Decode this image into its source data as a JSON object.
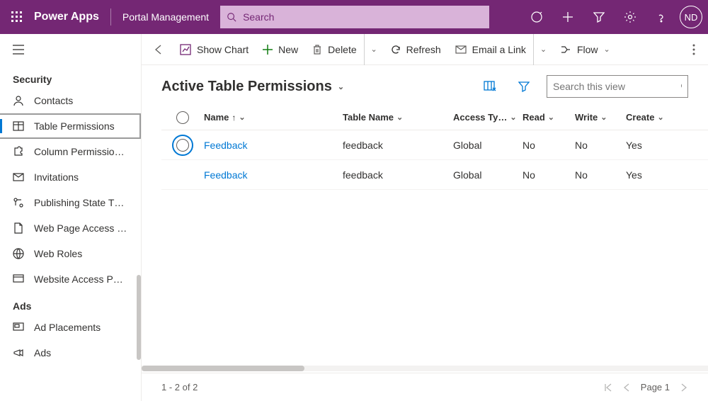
{
  "header": {
    "brand": "Power Apps",
    "appname": "Portal Management",
    "search_placeholder": "Search",
    "avatar": "ND"
  },
  "sidebar": {
    "groups": [
      {
        "label": "Security",
        "items": [
          {
            "label": "Contacts"
          },
          {
            "label": "Table Permissions",
            "selected": true
          },
          {
            "label": "Column Permissio…"
          },
          {
            "label": "Invitations"
          },
          {
            "label": "Publishing State T…"
          },
          {
            "label": "Web Page Access …"
          },
          {
            "label": "Web Roles"
          },
          {
            "label": "Website Access P…"
          }
        ]
      },
      {
        "label": "Ads",
        "items": [
          {
            "label": "Ad Placements"
          },
          {
            "label": "Ads"
          }
        ]
      }
    ]
  },
  "commands": {
    "show_chart": "Show Chart",
    "new": "New",
    "delete": "Delete",
    "refresh": "Refresh",
    "email_link": "Email a Link",
    "flow": "Flow"
  },
  "view": {
    "title": "Active Table Permissions",
    "search_placeholder": "Search this view",
    "columns": [
      "Name",
      "Table Name",
      "Access Ty…",
      "Read",
      "Write",
      "Create"
    ],
    "rows": [
      {
        "name": "Feedback",
        "table": "feedback",
        "access": "Global",
        "read": "No",
        "write": "No",
        "create": "Yes",
        "active": true
      },
      {
        "name": "Feedback",
        "table": "feedback",
        "access": "Global",
        "read": "No",
        "write": "No",
        "create": "Yes"
      }
    ]
  },
  "footer": {
    "range": "1 - 2 of 2",
    "page": "Page 1"
  }
}
